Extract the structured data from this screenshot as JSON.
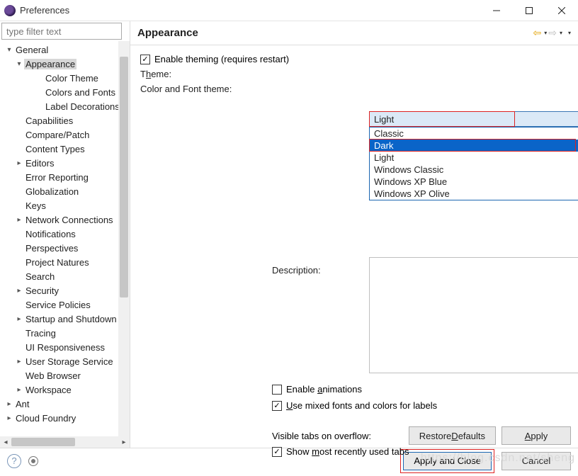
{
  "window": {
    "title": "Preferences"
  },
  "filter": {
    "placeholder": "type filter text"
  },
  "tree": {
    "general": "General",
    "appearance": "Appearance",
    "color_theme": "Color Theme",
    "colors_and_fonts": "Colors and Fonts",
    "label_decorations": "Label Decorations",
    "capabilities": "Capabilities",
    "compare_patch": "Compare/Patch",
    "content_types": "Content Types",
    "editors": "Editors",
    "error_reporting": "Error Reporting",
    "globalization": "Globalization",
    "keys": "Keys",
    "network": "Network Connections",
    "notifications": "Notifications",
    "perspectives": "Perspectives",
    "project_natures": "Project Natures",
    "search": "Search",
    "security": "Security",
    "service_policies": "Service Policies",
    "startup_shutdown": "Startup and Shutdown",
    "tracing": "Tracing",
    "ui_responsiveness": "UI Responsiveness",
    "user_storage": "User Storage Service",
    "web_browser": "Web Browser",
    "workspace": "Workspace",
    "ant": "Ant",
    "cloud_foundry": "Cloud Foundry"
  },
  "page": {
    "heading": "Appearance",
    "enable_theming": "Enable theming (requires restart)",
    "theme_label_pre": "T",
    "theme_label_u": "h",
    "theme_label_post": "eme:",
    "cft_label": "Color and Font theme:",
    "desc_label": "Description:",
    "enable_anim_pre": "Enable ",
    "enable_anim_u": "a",
    "enable_anim_post": "nimations",
    "mixed_pre": "",
    "mixed_u": "U",
    "mixed_post": "se mixed fonts and colors for labels",
    "visible_label": "Visible tabs on overflow:",
    "show_pre": "Show ",
    "show_u": "m",
    "show_post": "ost recently used tabs",
    "restore_pre": "Restore ",
    "restore_u": "D",
    "restore_post": "efaults",
    "apply_u": "A",
    "apply_post": "pply",
    "apply_close": "Apply and Close",
    "cancel": "Cancel"
  },
  "theme": {
    "selected": "Light",
    "options": [
      "Classic",
      "Dark",
      "Light",
      "Windows Classic",
      "Windows XP Blue",
      "Windows XP Olive"
    ]
  },
  "checks": {
    "theming": true,
    "animations": false,
    "mixed": true,
    "show_recent": true
  },
  "watermark": "https://blog.csdn.net/sheng"
}
